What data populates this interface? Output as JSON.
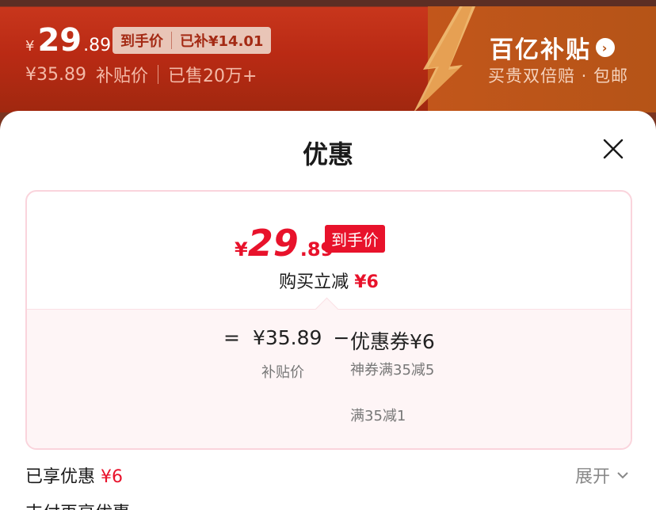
{
  "banner": {
    "currency": "¥",
    "price_int": "29",
    "price_dec": ".89",
    "tag_label": "到手价",
    "tag_subsidy": "已补¥14.01",
    "original_price": "¥35.89",
    "subsidy_label": "补贴价",
    "sold": "已售20万+",
    "brand": "百亿补贴",
    "brand_sub": "买贵双倍赔 · 包邮"
  },
  "sheet": {
    "title": "优惠",
    "final": {
      "currency": "¥",
      "price_int": "29",
      "price_dec": ".89",
      "tag": "到手价"
    },
    "instant_label": "购买立减",
    "instant_value": "¥6",
    "calc": {
      "equals": "=",
      "base_price": "¥35.89",
      "minus": "−",
      "base_label": "补贴价",
      "coupon_head": "优惠券¥6",
      "coupons": [
        "神券满35减5",
        "满35减1"
      ]
    },
    "enjoyed_label": "已享优惠",
    "enjoyed_value": "¥6",
    "expand_label": "展开",
    "next_section": "支付再享优惠"
  },
  "colors": {
    "accent_red": "#e8122b",
    "banner_red": "#b92a14",
    "banner_orange": "#c2561b"
  }
}
